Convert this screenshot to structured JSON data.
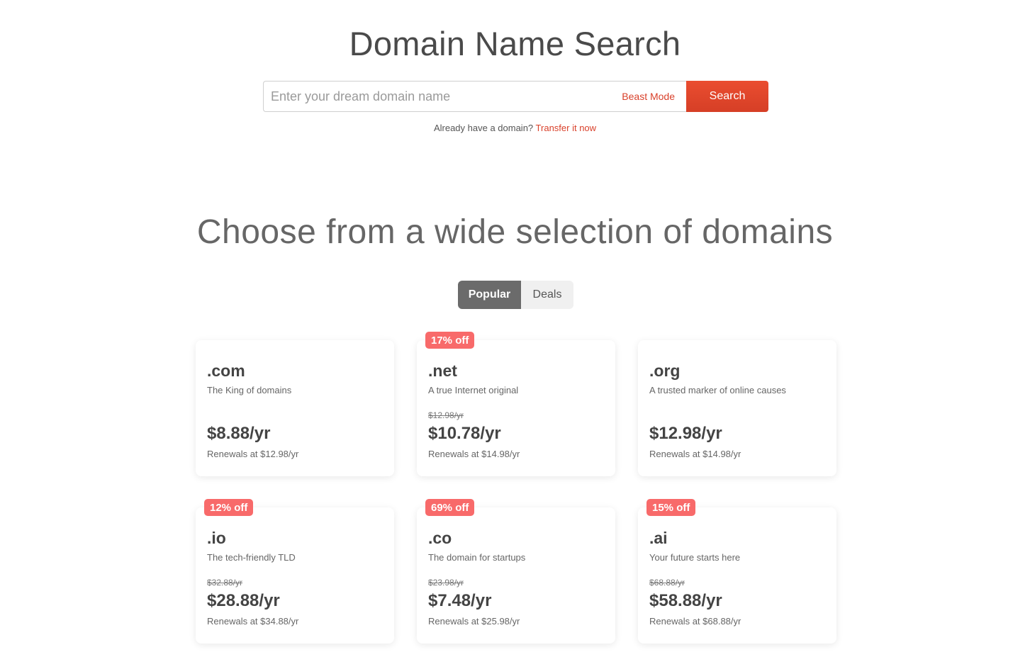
{
  "header": {
    "title": "Domain Name Search"
  },
  "search": {
    "placeholder": "Enter your dream domain name",
    "value": "",
    "beast_mode_label": "Beast Mode",
    "button_label": "Search"
  },
  "transfer": {
    "prompt": "Already have a domain?",
    "link_label": "Transfer it now"
  },
  "selection": {
    "title": "Choose from a wide selection of domains",
    "tabs": [
      {
        "label": "Popular",
        "active": true
      },
      {
        "label": "Deals",
        "active": false
      }
    ]
  },
  "colors": {
    "accent": "#e5472d",
    "badge": "#f86a6a",
    "active_tab": "#6b6b6b"
  },
  "domains": [
    {
      "tld": ".com",
      "tagline": "The King of domains",
      "badge": "",
      "old_price": "",
      "price": "$8.88/yr",
      "renewal": "Renewals at $12.98/yr"
    },
    {
      "tld": ".net",
      "tagline": "A true Internet original",
      "badge": "17% off",
      "old_price": "$12.98/yr",
      "price": "$10.78/yr",
      "renewal": "Renewals at $14.98/yr"
    },
    {
      "tld": ".org",
      "tagline": "A trusted marker of online causes",
      "badge": "",
      "old_price": "",
      "price": "$12.98/yr",
      "renewal": "Renewals at $14.98/yr"
    },
    {
      "tld": ".io",
      "tagline": "The tech-friendly TLD",
      "badge": "12% off",
      "old_price": "$32.88/yr",
      "price": "$28.88/yr",
      "renewal": "Renewals at $34.88/yr"
    },
    {
      "tld": ".co",
      "tagline": "The domain for startups",
      "badge": "69% off",
      "old_price": "$23.98/yr",
      "price": "$7.48/yr",
      "renewal": "Renewals at $25.98/yr"
    },
    {
      "tld": ".ai",
      "tagline": "Your future starts here",
      "badge": "15% off",
      "old_price": "$68.88/yr",
      "price": "$58.88/yr",
      "renewal": "Renewals at $68.88/yr"
    }
  ]
}
